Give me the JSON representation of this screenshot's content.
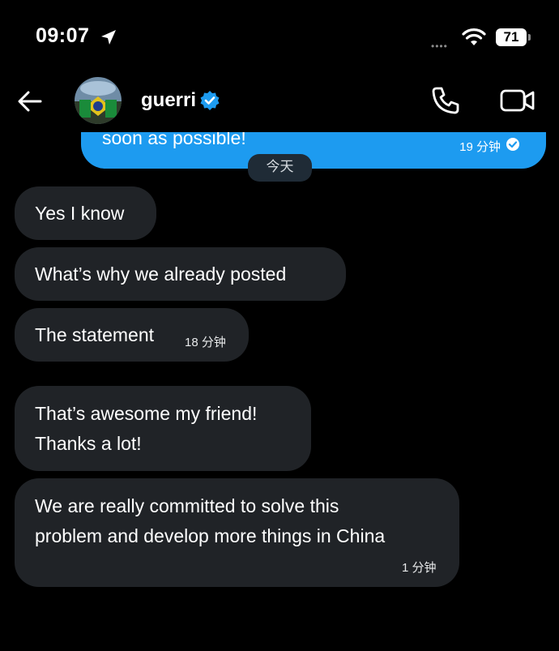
{
  "status_bar": {
    "time": "09:07",
    "battery": "71",
    "signal": "••••"
  },
  "header": {
    "name": "guerri"
  },
  "sent_message": {
    "text": "soon as possible!",
    "time": "19 分钟"
  },
  "date_divider": "今天",
  "received": [
    {
      "text": "Yes I know"
    },
    {
      "text": "What’s why we already posted"
    },
    {
      "text": "The statement",
      "time": "18 分钟"
    },
    {
      "line1": "That’s awesome my friend!",
      "line2": "Thanks a lot!"
    },
    {
      "line1": "We are really committed to solve this",
      "line2": "problem and develop more things in China",
      "time": "1 分钟"
    }
  ],
  "colors": {
    "accent": "#1d9bf0",
    "bubble": "#202327",
    "background": "#000000"
  }
}
